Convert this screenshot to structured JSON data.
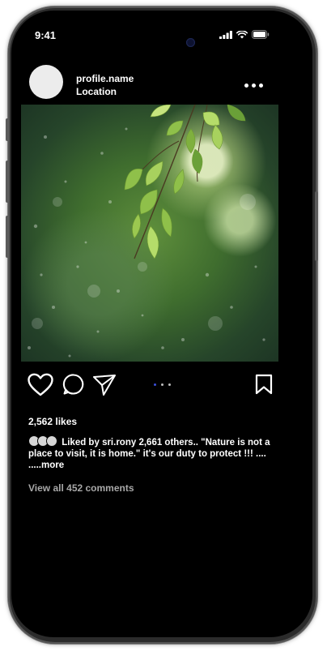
{
  "status_bar": {
    "time": "9:41",
    "icons": [
      "signal-icon",
      "wifi-icon",
      "battery-icon"
    ]
  },
  "post": {
    "profile_name": "profile.name",
    "location": "Location",
    "image": "green-leaves-bokeh-photo",
    "carousel": {
      "count": 3,
      "active_index": 0
    },
    "likes": "2,562 likes",
    "caption": {
      "liked_by_label": "Liked  by",
      "liked_by_user": "sri.rony",
      "others": "2,661 others..",
      "text": "\"Nature is not a place to visit, it is home.\" it's our duty to protect !!! .... .....more"
    },
    "view_comments": "View all 452 comments"
  },
  "colors": {
    "background": "#000000",
    "text": "#ffffff",
    "muted": "#a8a8a8",
    "carousel_active": "#3b4fd8"
  }
}
